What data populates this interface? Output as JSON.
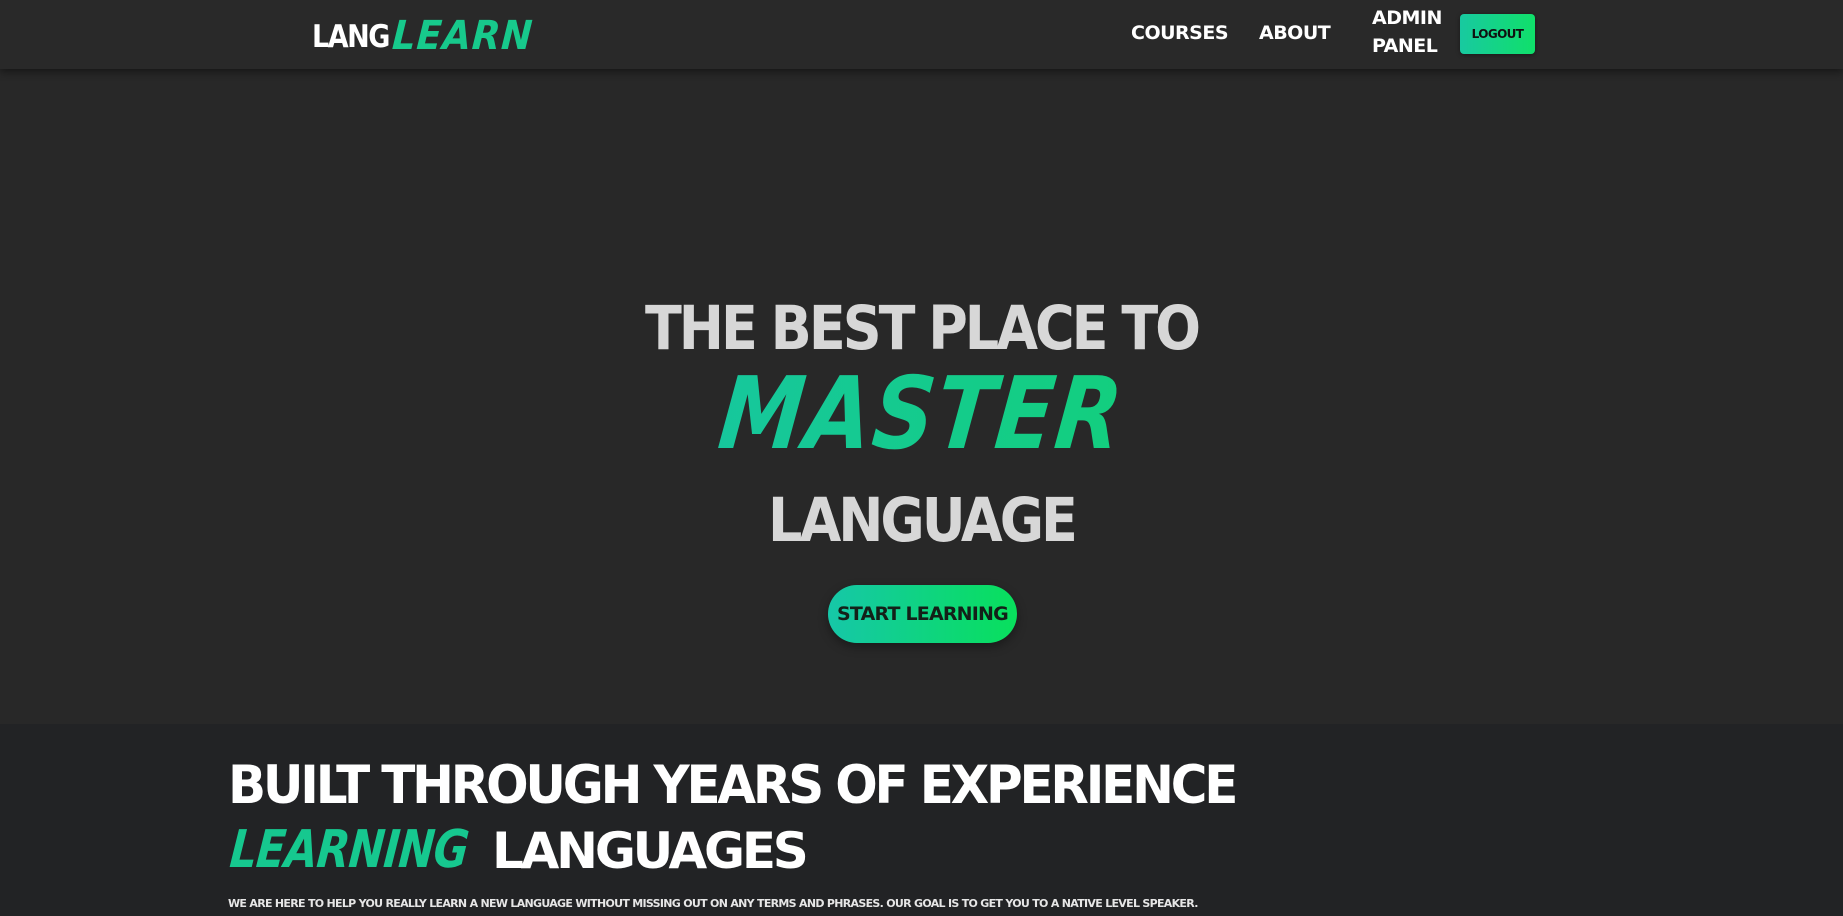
{
  "brand": {
    "prefix": "LANG",
    "suffix": "LEARN",
    "accent_color": "#17c98c"
  },
  "nav": {
    "links": [
      {
        "label": "COURSES"
      },
      {
        "label": "ABOUT"
      },
      {
        "label": "ADMIN PANEL"
      }
    ],
    "logout_label": "LOGOUT"
  },
  "hero": {
    "line1": "THE BEST PLACE TO",
    "highlight": "MASTER",
    "line3": "LANGUAGE",
    "cta_label": "START LEARNING"
  },
  "experience": {
    "title": "BUILT THROUGH YEARS OF EXPERIENCE",
    "highlight": "LEARNING",
    "title_end": "LANGUAGES",
    "description": "WE ARE HERE TO HELP YOU REALLY LEARN A NEW LANGUAGE WITHOUT MISSING OUT ON ANY TERMS AND PHRASES. OUR GOAL IS TO GET YOU TO A NATIVE LEVEL SPEAKER."
  },
  "colors": {
    "background": "#282828",
    "header": "#292929",
    "section": "#222325",
    "accent_start": "#18c9a0",
    "accent_end": "#10e06a"
  }
}
